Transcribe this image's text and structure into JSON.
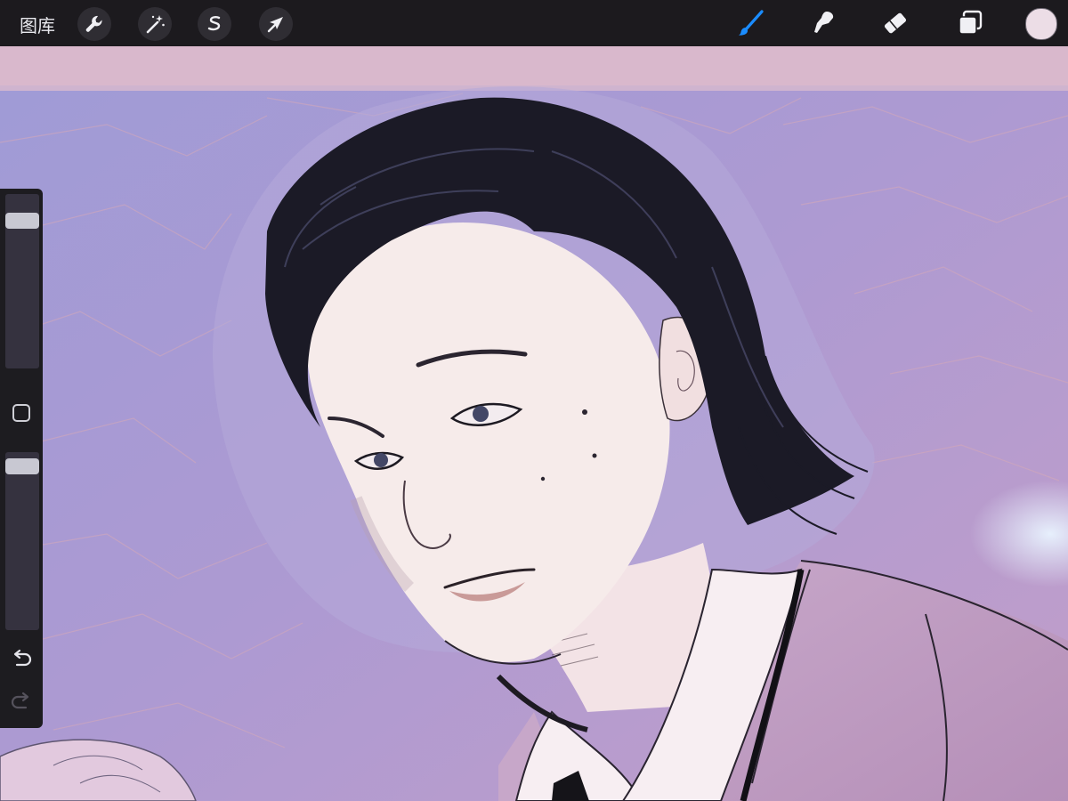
{
  "topbar": {
    "gallery_label": "图库",
    "left_tools": [
      {
        "icon": "wrench-icon",
        "name": "actions"
      },
      {
        "icon": "magic-wand-icon",
        "name": "adjustments"
      },
      {
        "icon": "s-selection-icon",
        "name": "selection"
      },
      {
        "icon": "arrow-cursor-icon",
        "name": "transform"
      }
    ],
    "right_tools": [
      {
        "icon": "brush-icon",
        "name": "paint",
        "active": true
      },
      {
        "icon": "smudge-icon",
        "name": "smudge",
        "active": false
      },
      {
        "icon": "eraser-icon",
        "name": "eraser",
        "active": false
      },
      {
        "icon": "layers-icon",
        "name": "layers",
        "active": false
      }
    ],
    "current_color": "#ecdde6"
  },
  "sidebar": {
    "brush_size_level": 0.88,
    "opacity_level": 0.96,
    "undo_icon": "undo-icon",
    "redo_icon": "redo-icon",
    "redo_enabled": false
  },
  "colors": {
    "accent": "#1a8cff",
    "toolbar_bg": "#1c1a1e",
    "canvas_bg": "#a89bd6",
    "skin": "#f6ebea",
    "hair": "#1b1a26",
    "suit": "#c8a6c8"
  }
}
